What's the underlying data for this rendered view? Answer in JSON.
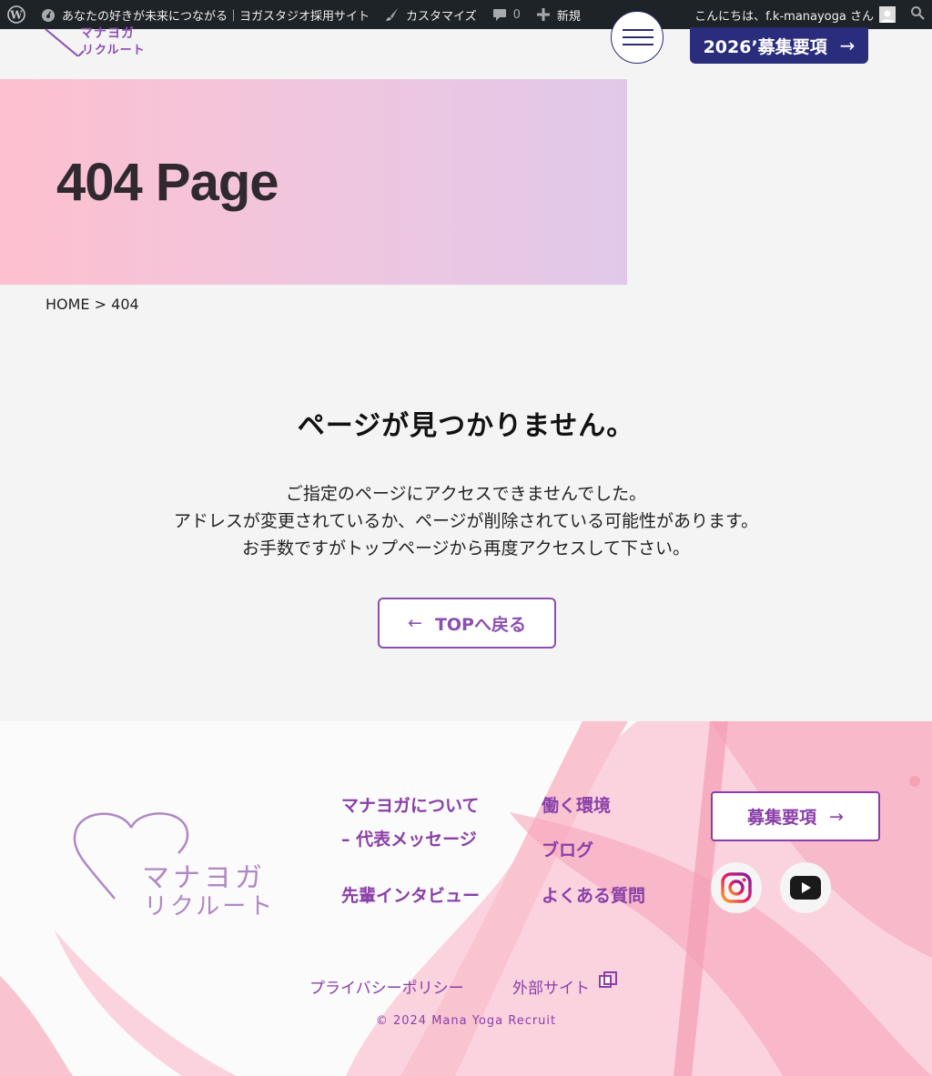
{
  "adminbar": {
    "site_name": "あなたの好きが未来につながる｜ヨガスタジオ採用サイト",
    "customize": "カスタマイズ",
    "comments_count": "0",
    "new_label": "新規",
    "greeting": "こんにちは、f.k-manayoga さん"
  },
  "header": {
    "logo_line1": "マナヨガ",
    "logo_line2": "リクルート",
    "recruit_button": "2026’募集要項",
    "arrow": "→"
  },
  "hero": {
    "title": "404 Page"
  },
  "breadcrumb": {
    "home": "HOME",
    "separator": ">",
    "current": "404"
  },
  "main": {
    "title": "ページが見つかりません。",
    "lines": [
      "ご指定のページにアクセスできませんでした。",
      "アドレスが変更されているか、ページが削除されている可能性があります。",
      "お手数ですがトップページから再度アクセスして下さい。"
    ],
    "back_arrow": "←",
    "back_button": "TOPへ戻る"
  },
  "footer": {
    "logo_line1": "マナヨガ",
    "logo_line2": "リクルート",
    "nav": {
      "about": "マナヨガについて",
      "message": "– 代表メッセージ",
      "work": "働く環境",
      "blog": "ブログ",
      "interview": "先輩インタビュー",
      "faq": "よくある質問"
    },
    "recruit_button": "募集要項",
    "arrow": "→",
    "privacy": "プライバシーポリシー",
    "external": "外部サイト",
    "copyright": "© 2024 Mana Yoga Recruit"
  }
}
